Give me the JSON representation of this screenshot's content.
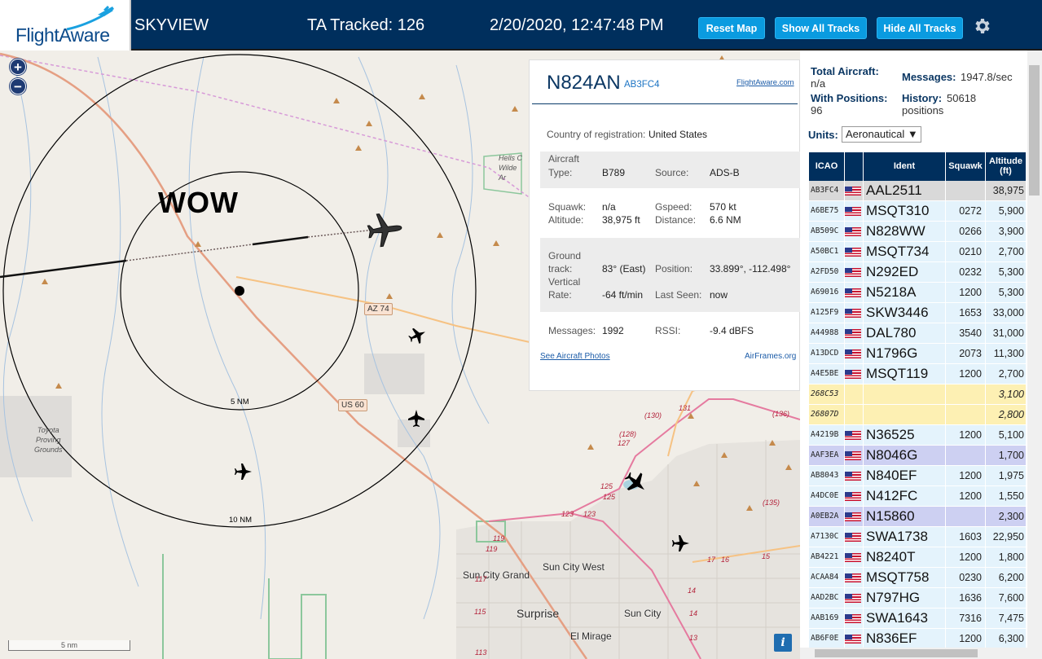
{
  "header": {
    "logo_text": "FlightAware",
    "app_title": "SKYVIEW",
    "tracked": "TA Tracked: 126",
    "datetime": "2/20/2020, 12:47:48 PM",
    "buttons": {
      "reset_map": "Reset Map",
      "show_all": "Show All Tracks",
      "hide_all": "Hide All Tracks"
    },
    "settings_icon": "gear-icon"
  },
  "map": {
    "zoom_in": "+",
    "zoom_out": "−",
    "overlay_text": "WOW",
    "ring_labels": {
      "inner": "5 NM",
      "outer": "10 NM"
    },
    "places": {
      "sun_city_grand": "Sun City Grand",
      "sun_city_west": "Sun City West",
      "surprise": "Surprise",
      "sun_city": "Sun City",
      "el_mirage": "El Mirage",
      "hells_canyon": "Hells C\nWilde\nAr",
      "toyota": "Toyota\nProving\nGrounds"
    },
    "roads": {
      "az74": "AZ 74",
      "us60": "US 60"
    },
    "road_numbers": [
      "131",
      "(130)",
      "(136)",
      "(128)",
      "127",
      "125",
      "125",
      "123",
      "123",
      "119",
      "119",
      "117",
      "115",
      "113",
      "17",
      "16",
      "15",
      "14",
      "14",
      "13",
      "(135)"
    ],
    "scale_label": "5 nm",
    "info": "i"
  },
  "popup": {
    "registration": "N824AN",
    "hex": "AB3FC4",
    "link": "FlightAware.com",
    "country_label": "Country of registration:",
    "country_value": "United States",
    "aircraft_label": "Aircraft",
    "type_label": "Type:",
    "type_value": "B789",
    "source_label": "Source:",
    "source_value": "ADS-B",
    "squawk_label": "Squawk:",
    "squawk_value": "n/a",
    "gspeed_label": "Gspeed:",
    "gspeed_value": "570 kt",
    "altitude_label": "Altitude:",
    "altitude_value": "38,975 ft",
    "distance_label": "Distance:",
    "distance_value": "6.6 NM",
    "ground_label": "Ground",
    "track_label": "track:",
    "track_value": "83° (East)",
    "position_label": "Position:",
    "position_value": "33.899°, -112.498°",
    "vertical_label": "Vertical",
    "rate_label": "Rate:",
    "rate_value": "-64 ft/min",
    "lastseen_label": "Last Seen:",
    "lastseen_value": "now",
    "messages_label": "Messages:",
    "messages_value": "1992",
    "rssi_label": "RSSI:",
    "rssi_value": "-9.4 dBFS",
    "photos_link": "See Aircraft Photos",
    "airframes_link": "AirFrames.org"
  },
  "side": {
    "total_label": "Total Aircraft:",
    "total_value": "n/a",
    "messages_label": "Messages:",
    "messages_value": "1947.8/sec",
    "withpos_label": "With Positions:",
    "withpos_value": "96",
    "history_label": "History:",
    "history_value": "50618",
    "history_unit": "positions",
    "units_label": "Units:",
    "units_value": "Aeronautical ▼",
    "columns": {
      "icao": "ICAO",
      "ident": "Ident",
      "squawk": "Squawk",
      "altitude": "Altitude",
      "altitude_unit": "(ft)"
    },
    "rows": [
      {
        "icao": "AB3FC4",
        "flag": true,
        "ident": "AAL2511",
        "squawk": "",
        "alt": "38,975",
        "state": "selected"
      },
      {
        "icao": "A6BE75",
        "flag": true,
        "ident": "MSQT310",
        "squawk": "0272",
        "alt": "5,900",
        "state": "normal"
      },
      {
        "icao": "AB509C",
        "flag": true,
        "ident": "N828WW",
        "squawk": "0266",
        "alt": "3,900",
        "state": "normal"
      },
      {
        "icao": "A50BC1",
        "flag": true,
        "ident": "MSQT734",
        "squawk": "0210",
        "alt": "2,700",
        "state": "normal"
      },
      {
        "icao": "A2FD50",
        "flag": true,
        "ident": "N292ED",
        "squawk": "0232",
        "alt": "5,300",
        "state": "normal"
      },
      {
        "icao": "A69016",
        "flag": true,
        "ident": "N5218A",
        "squawk": "1200",
        "alt": "5,300",
        "state": "normal"
      },
      {
        "icao": "A125F9",
        "flag": true,
        "ident": "SKW3446",
        "squawk": "1653",
        "alt": "33,000",
        "state": "normal"
      },
      {
        "icao": "A44988",
        "flag": true,
        "ident": "DAL780",
        "squawk": "3540",
        "alt": "31,000",
        "state": "normal"
      },
      {
        "icao": "A13DCD",
        "flag": true,
        "ident": "N1796G",
        "squawk": "2073",
        "alt": "11,300",
        "state": "normal"
      },
      {
        "icao": "A4E5BE",
        "flag": true,
        "ident": "MSQT119",
        "squawk": "1200",
        "alt": "2,700",
        "state": "normal"
      },
      {
        "icao": "268C53",
        "flag": false,
        "ident": "",
        "squawk": "",
        "alt": "3,100",
        "state": "mlat"
      },
      {
        "icao": "26807D",
        "flag": false,
        "ident": "",
        "squawk": "",
        "alt": "2,800",
        "state": "mlat"
      },
      {
        "icao": "A4219B",
        "flag": true,
        "ident": "N36525",
        "squawk": "1200",
        "alt": "5,100",
        "state": "normal"
      },
      {
        "icao": "AAF3EA",
        "flag": true,
        "ident": "N8046G",
        "squawk": "",
        "alt": "1,700",
        "state": "tisb"
      },
      {
        "icao": "AB8043",
        "flag": true,
        "ident": "N840EF",
        "squawk": "1200",
        "alt": "1,975",
        "state": "normal"
      },
      {
        "icao": "A4DC0E",
        "flag": true,
        "ident": "N412FC",
        "squawk": "1200",
        "alt": "1,550",
        "state": "normal"
      },
      {
        "icao": "A0EB2A",
        "flag": true,
        "ident": "N15860",
        "squawk": "",
        "alt": "2,300",
        "state": "tisb"
      },
      {
        "icao": "A7130C",
        "flag": true,
        "ident": "SWA1738",
        "squawk": "1603",
        "alt": "22,950",
        "state": "normal"
      },
      {
        "icao": "AB4221",
        "flag": true,
        "ident": "N8240T",
        "squawk": "1200",
        "alt": "1,800",
        "state": "normal"
      },
      {
        "icao": "ACAA84",
        "flag": true,
        "ident": "MSQT758",
        "squawk": "0230",
        "alt": "6,200",
        "state": "normal"
      },
      {
        "icao": "AAD2BC",
        "flag": true,
        "ident": "N797HG",
        "squawk": "1636",
        "alt": "7,600",
        "state": "normal"
      },
      {
        "icao": "AAB169",
        "flag": true,
        "ident": "SWA1643",
        "squawk": "7316",
        "alt": "7,475",
        "state": "normal"
      },
      {
        "icao": "AB6F0E",
        "flag": true,
        "ident": "N836EF",
        "squawk": "1200",
        "alt": "6,300",
        "state": "normal"
      }
    ]
  },
  "colors": {
    "header_bg": "#002f5d",
    "button_bg": "#0a9be0",
    "row_normal": "#e4f3fc",
    "row_selected": "#d9d9d9",
    "row_mlat": "#fdf0b3",
    "row_tisb": "#cdd0f2"
  }
}
